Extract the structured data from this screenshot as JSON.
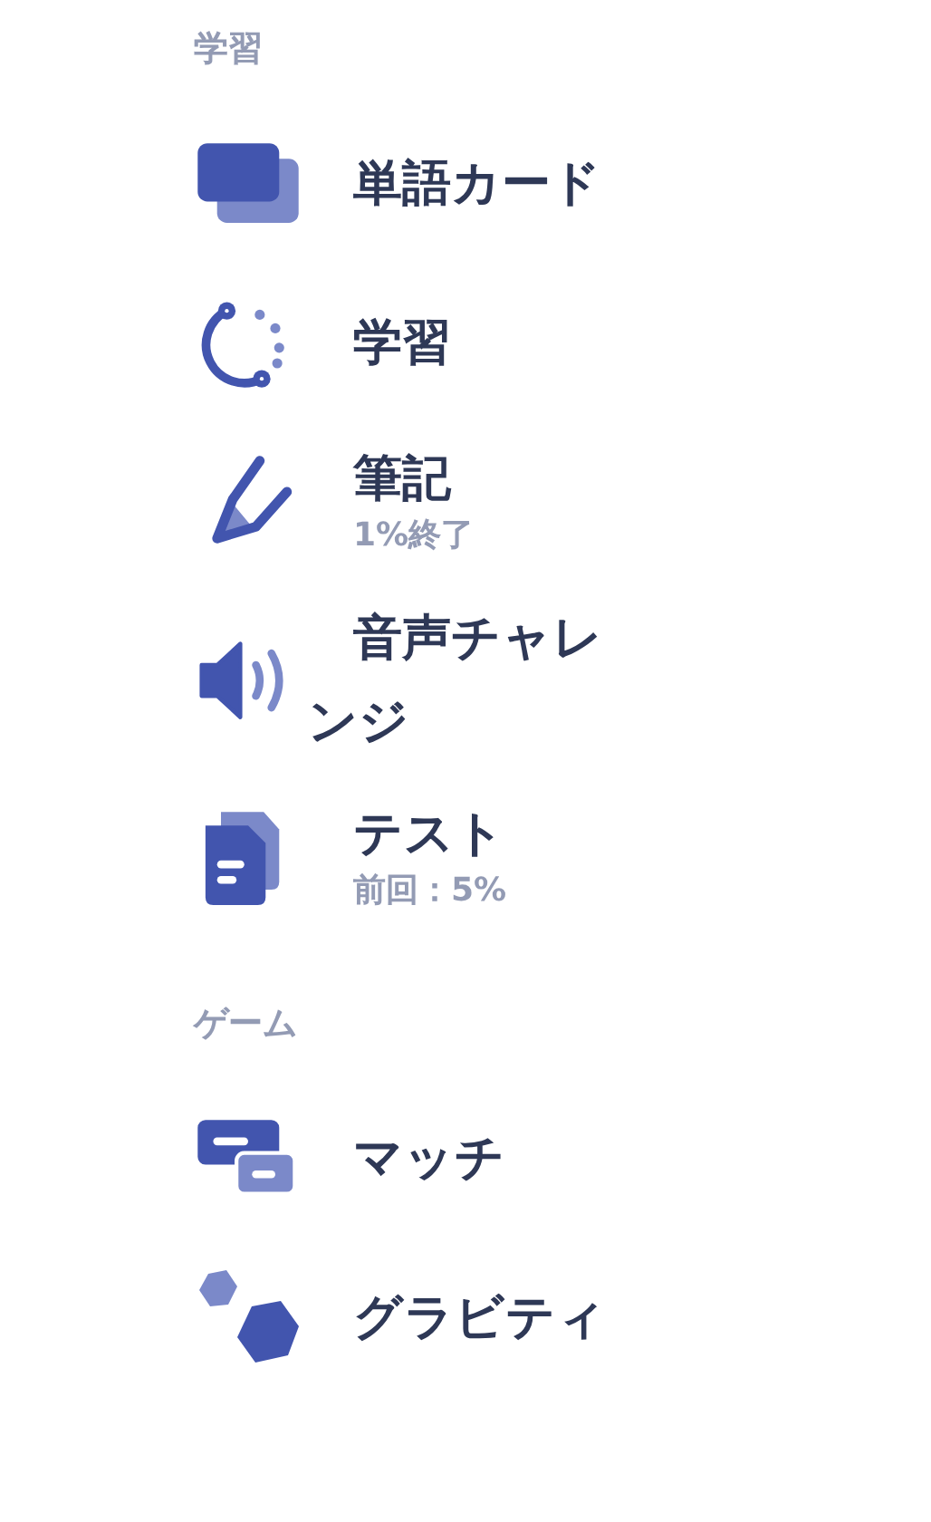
{
  "sections": [
    {
      "title": "学習",
      "items": [
        {
          "kind": "cards",
          "label": "単語カード"
        },
        {
          "kind": "learn",
          "label": "学習"
        },
        {
          "kind": "write",
          "label": "筆記",
          "subtitle": "1%終了"
        },
        {
          "kind": "spell",
          "label": "音声チャレンジ"
        },
        {
          "kind": "test",
          "label": "テスト",
          "subtitle": "前回：5%"
        }
      ]
    },
    {
      "title": "ゲーム",
      "items": [
        {
          "kind": "match",
          "label": "マッチ"
        },
        {
          "kind": "gravity",
          "label": "グラビティ"
        }
      ]
    }
  ]
}
